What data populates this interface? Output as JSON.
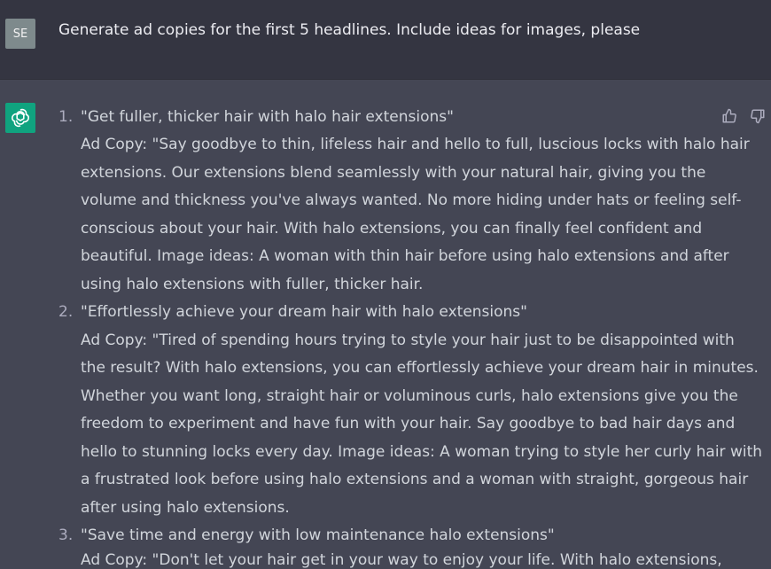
{
  "user_message": {
    "avatar_initials": "SE",
    "text": "Generate ad copies for the first 5 headlines. Include ideas for images, please"
  },
  "assistant": {
    "avatar_icon": "openai-logo-icon",
    "feedback": {
      "thumbs_up_icon": "thumbs-up-icon",
      "thumbs_down_icon": "thumbs-down-icon"
    },
    "items": [
      {
        "number": "1.",
        "headline": "\"Get fuller, thicker hair with halo hair extensions\"",
        "lines": [
          "Ad Copy: \"Say goodbye to thin, lifeless hair and hello to full, luscious locks with halo hair",
          "extensions. Our extensions blend seamlessly with your natural hair, giving you the",
          "volume and thickness you've always wanted. No more hiding under hats or feeling self-",
          "conscious about your hair. With halo extensions, you can finally feel confident and",
          "beautiful. Image ideas: A woman with thin hair before using halo extensions and after",
          "using halo extensions with fuller, thicker hair."
        ]
      },
      {
        "number": "2.",
        "headline": "\"Effortlessly achieve your dream hair with halo extensions\"",
        "lines": [
          "Ad Copy: \"Tired of spending hours trying to style your hair just to be disappointed with",
          "the result? With halo extensions, you can effortlessly achieve your dream hair in minutes.",
          "Whether you want long, straight hair or voluminous curls, halo extensions give you the",
          "freedom to experiment and have fun with your hair. Say goodbye to bad hair days and",
          "hello to stunning locks every day. Image ideas: A woman trying to style her curly hair with",
          "a frustrated look before using halo extensions and a woman with straight, gorgeous hair",
          "after using halo extensions."
        ]
      },
      {
        "number": "3.",
        "headline": "\"Save time and energy with low maintenance halo extensions\"",
        "lines": [
          "Ad Copy: \"Don't let your hair get in your way to enjoy your life. With halo extensions,"
        ]
      }
    ]
  }
}
